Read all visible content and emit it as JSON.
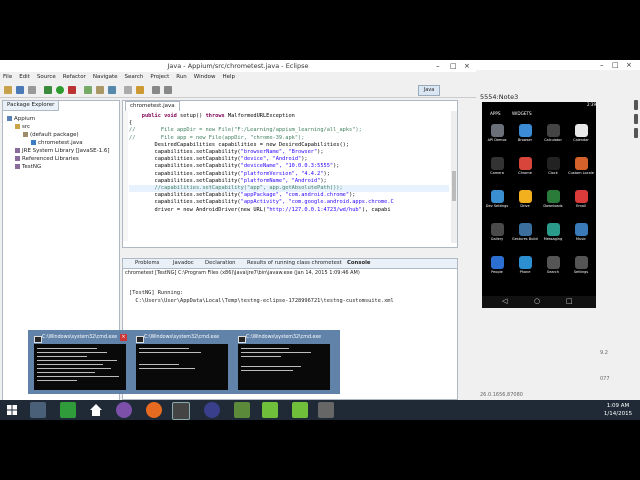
{
  "eclipse": {
    "title": "Java - Appium/src/chrometest.java - Eclipse",
    "menu": [
      "File",
      "Edit",
      "Source",
      "Refactor",
      "Navigate",
      "Search",
      "Project",
      "Run",
      "Window",
      "Help"
    ],
    "perspective": "Java",
    "package_explorer": {
      "tab": "Package Explorer",
      "project": "Appium",
      "src": "src",
      "default_package": "(default package)",
      "file": "chrometest.java",
      "jre": "JRE System Library [JavaSE-1.6]",
      "ref_libs": "Referenced Libraries",
      "testng": "TestNG"
    },
    "editor": {
      "tab": "chrometest.java",
      "lines": [
        {
          "k": "public void ",
          "t": "setup() ",
          "k2": "throws ",
          "t2": "MalformedURLException"
        },
        {
          "t": "{"
        },
        {
          "c": "//        File appDir = new File(\"F:/Learning/appium_learning/all_apks\");"
        },
        {
          "c": "//        File app = new File(appDir, \"chrome-39.apk\");"
        },
        {
          "t": ""
        },
        {
          "t": "        DesiredCapabilities capabilities = new DesiredCapabilities();"
        },
        {
          "t": "        capabilities.setCapability(",
          "s": "\"browserName\", \"Browser\"",
          "e": ");"
        },
        {
          "t": "        capabilities.setCapability(",
          "s": "\"device\", \"Android\"",
          "e": ");"
        },
        {
          "t": "        capabilities.setCapability(",
          "s": "\"deviceName\", \"10.0.0.3:5555\"",
          "e": ");"
        },
        {
          "t": "        capabilities.setCapability(",
          "s": "\"platformVersion\", \"4.4.2\"",
          "e": ");"
        },
        {
          "t": "        capabilities.setCapability(",
          "s": "\"platformName\", \"Android\"",
          "e": ");"
        },
        {
          "c": "        //capabilities.setCapability(\"app\", app.getAbsolutePath());",
          "hl": true
        },
        {
          "t": "        capabilities.setCapability(",
          "s": "\"appPackage\", \"com.android.chrome\"",
          "e": ");"
        },
        {
          "t": "        capabilities.setCapability(",
          "s": "\"appActivity\", \"com.google.android.apps.chrome.C",
          "e": ""
        },
        {
          "t": ""
        },
        {
          "t": "        driver = new AndroidDriver(new URL(",
          "s": "\"http://127.0.0.1:4723/wd/hub\"",
          "e": "), capabi"
        }
      ]
    },
    "console": {
      "tabs": [
        "Problems",
        "Javadoc",
        "Declaration",
        "Results of running class chrometest",
        "Console"
      ],
      "description": "chrometest [TestNG] C:\\Program Files (x86)\\Java\\jre7\\bin\\javaw.exe (Jan 14, 2015 1:09:46 AM)",
      "output": [
        "[TestNG] Running:",
        "  C:\\Users\\User\\AppData\\Local\\Temp\\testng-eclipse-1728996721\\testng-customsuite.xml"
      ]
    }
  },
  "emulator": {
    "title": "5554:Note3",
    "clock": "2:39",
    "tabs": [
      "APPS",
      "WIDGETS"
    ],
    "apps": [
      "API Demos",
      "Browser",
      "Calculator",
      "Calendar",
      "Camera",
      "Chrome",
      "Clock",
      "Custom Locale",
      "Dev Settings",
      "Drive",
      "Downloads",
      "Email",
      "Gallery",
      "Gestures Builder",
      "Messaging",
      "Music",
      "People",
      "Phone",
      "Search",
      "Settings"
    ],
    "side_text": [
      "9.2",
      "077",
      "26.0.1656.87080"
    ]
  },
  "preview": {
    "windows": [
      "C:\\Windows\\system32\\cmd.exe",
      "C:\\Windows\\system32\\cmd.exe",
      "C:\\Windows\\system32\\cmd.exe"
    ]
  },
  "taskbar": {
    "time": "1:09 AM",
    "date": "1/14/2015"
  },
  "colors": {
    "accent": "#2f7ad6",
    "taskbar": "#1f2a36"
  }
}
